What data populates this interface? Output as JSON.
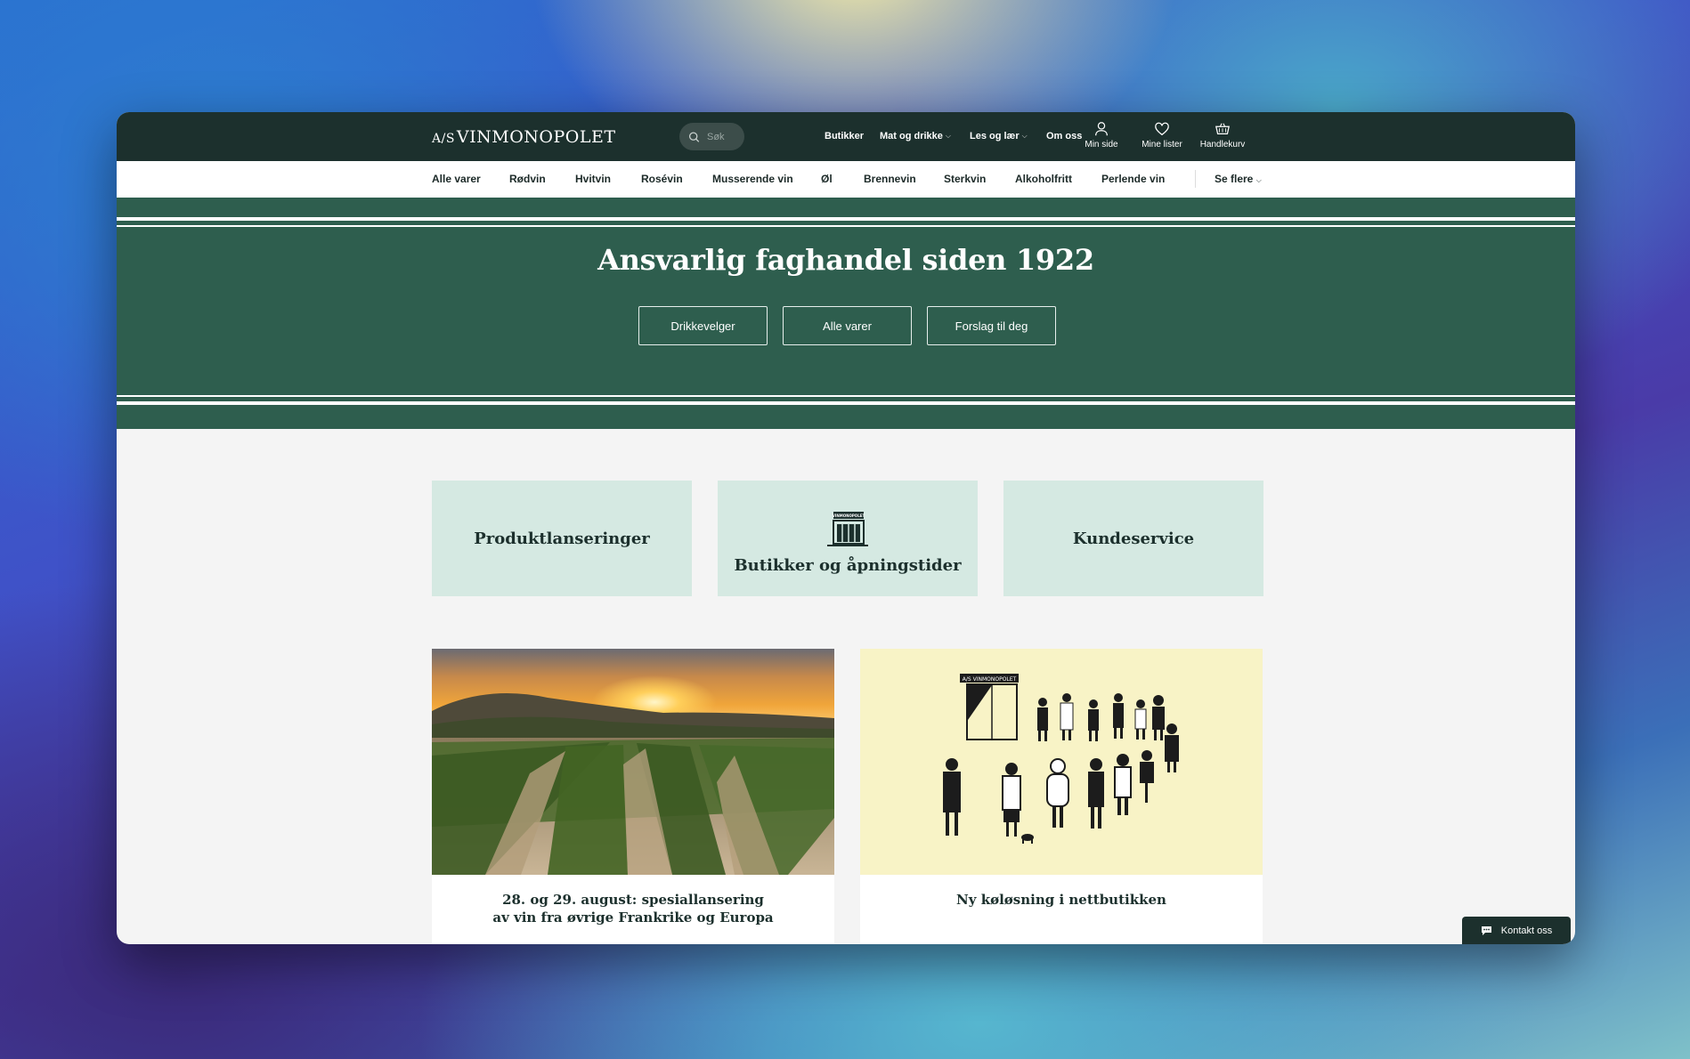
{
  "header": {
    "logo_mark": "A/S",
    "logo_text": "VINMONOPOLET",
    "search_placeholder": "Søk",
    "nav": [
      {
        "label": "Butikker"
      },
      {
        "label": "Mat og drikke"
      },
      {
        "label": "Les og lær"
      },
      {
        "label": "Om oss"
      }
    ],
    "icons": [
      {
        "label": "Min side",
        "icon": "user-icon"
      },
      {
        "label": "Mine lister",
        "icon": "heart-icon"
      },
      {
        "label": "Handlekurv",
        "icon": "basket-icon"
      }
    ]
  },
  "categories": [
    "Alle varer",
    "Rødvin",
    "Hvitvin",
    "Rosévin",
    "Musserende vin",
    "Øl",
    "Brennevin",
    "Sterkvin",
    "Alkoholfritt",
    "Perlende vin"
  ],
  "categories_more": "Se flere",
  "hero": {
    "title": "Ansvarlig faghandel siden 1922",
    "buttons": [
      "Drikkevelger",
      "Alle varer",
      "Forslag til deg"
    ]
  },
  "cards": [
    {
      "label": "Produktlanseringer"
    },
    {
      "label": "Butikker og åpningstider",
      "icon": "store-icon",
      "sign": "VINMONOPOLET"
    },
    {
      "label": "Kundeservice"
    }
  ],
  "articles": [
    {
      "title_line1": "28. og 29. august: spesiallansering",
      "title_line2": "av vin fra øvrige Frankrike og Europa",
      "image": "vineyard-sunset"
    },
    {
      "title_line1": "Ny køløsning i nettbutikken",
      "image": "queue-illustration",
      "sign": "A/S VINMONOPOLET"
    }
  ],
  "contact": {
    "label": "Kontakt oss",
    "icon": "chat-icon"
  },
  "colors": {
    "topbar": "#1c302d",
    "hero": "#2e5e4e",
    "card": "#d5e9e2",
    "illustration_bg": "#f8f3c6"
  }
}
